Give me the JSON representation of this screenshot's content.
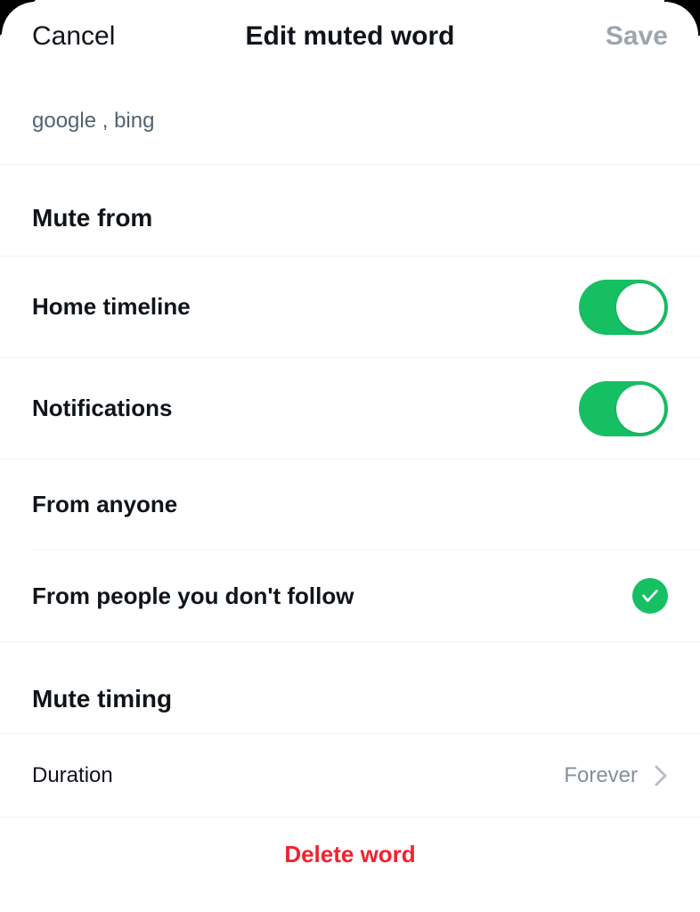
{
  "header": {
    "cancel": "Cancel",
    "title": "Edit muted word",
    "save": "Save"
  },
  "muted_word": "google , bing",
  "mute_from": {
    "heading": "Mute from",
    "home_timeline": {
      "label": "Home timeline",
      "enabled": true
    },
    "notifications": {
      "label": "Notifications",
      "enabled": true
    },
    "from_anyone": {
      "label": "From anyone",
      "selected": false
    },
    "from_not_following": {
      "label": "From people you don't follow",
      "selected": true
    }
  },
  "mute_timing": {
    "heading": "Mute timing",
    "duration": {
      "label": "Duration",
      "value": "Forever"
    }
  },
  "delete_label": "Delete word"
}
